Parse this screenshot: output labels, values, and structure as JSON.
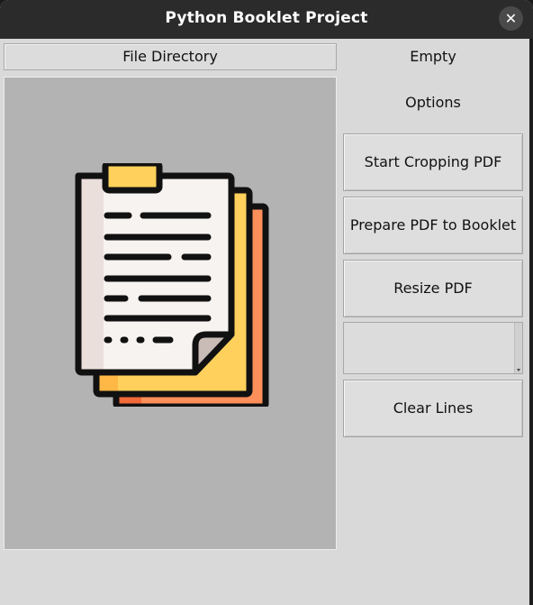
{
  "window": {
    "title": "Python Booklet Project",
    "close_glyph": "✕"
  },
  "left_panel": {
    "file_directory_label": "File Directory",
    "preview_icon": "document-pages-icon"
  },
  "right_panel": {
    "status_label": "Empty",
    "options_label": "Options",
    "buttons": {
      "start_cropping": "Start Cropping PDF",
      "prepare_booklet": "Prepare PDF to Booklet",
      "resize": "Resize PDF",
      "clear_lines": "Clear Lines"
    },
    "text_box_value": ""
  },
  "colors": {
    "titlebar": "#2b2b2b",
    "window_bg": "#d9d9d9",
    "preview_bg": "#b3b3b3",
    "icon_orange": "#ff8f5a",
    "icon_yellow": "#ffd15c",
    "icon_paper": "#f7f3f1",
    "icon_outline": "#111111"
  }
}
